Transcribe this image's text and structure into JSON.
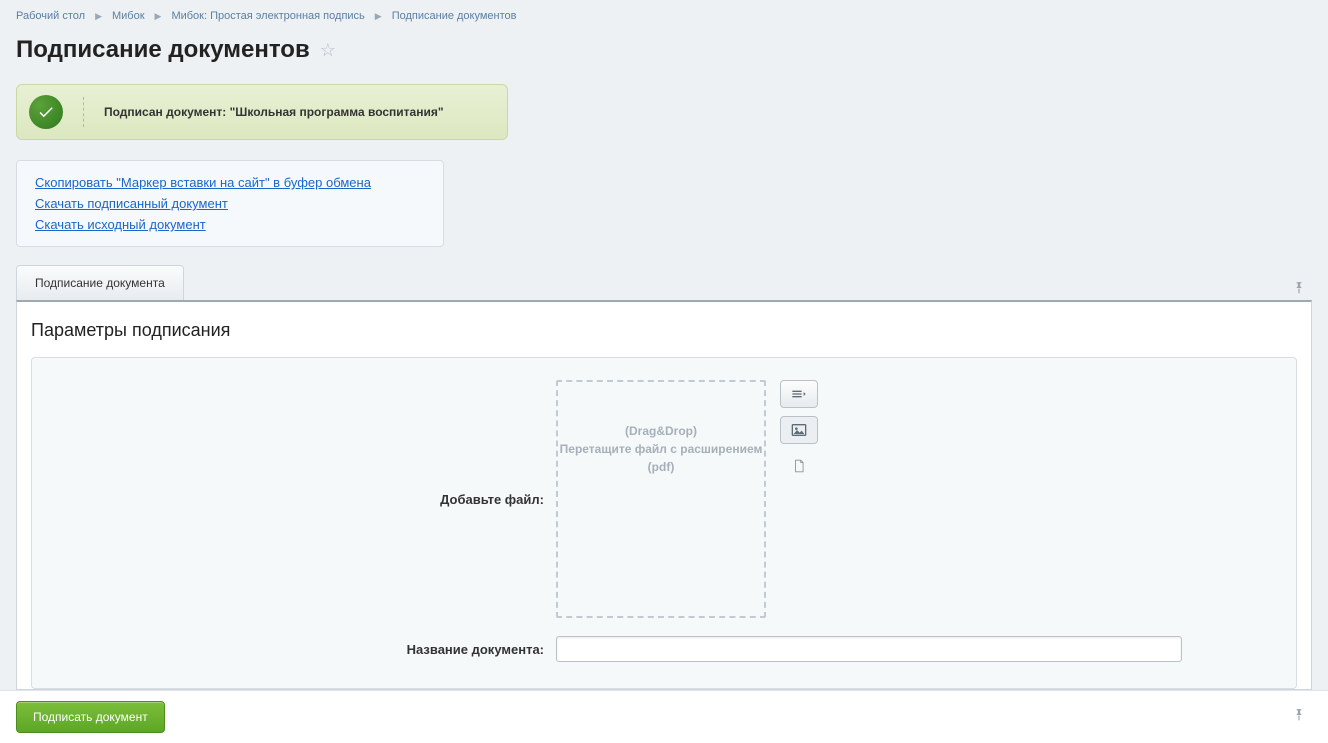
{
  "breadcrumb": {
    "items": [
      "Рабочий стол",
      "Мибок",
      "Мибок: Простая электронная подпись",
      "Подписание документов"
    ]
  },
  "page_title": "Подписание документов",
  "success": {
    "prefix": "Подписан документ:  ",
    "doc": "\"Школьная программа воспитания\""
  },
  "links": {
    "copy_marker": "Скопировать \"Маркер вставки на сайт\" в буфер обмена",
    "download_signed": "Скачать подписанный документ",
    "download_source": "Скачать исходный документ"
  },
  "tab_label": "Подписание документа",
  "section_title": "Параметры подписания",
  "form": {
    "add_file_label": "Добавьте файл:",
    "dropzone_line1": "(Drag&Drop)",
    "dropzone_line2": "Перетащите файл с расширением (pdf)",
    "doc_name_label": "Название документа:",
    "doc_name_value": ""
  },
  "submit_label": "Подписать документ"
}
